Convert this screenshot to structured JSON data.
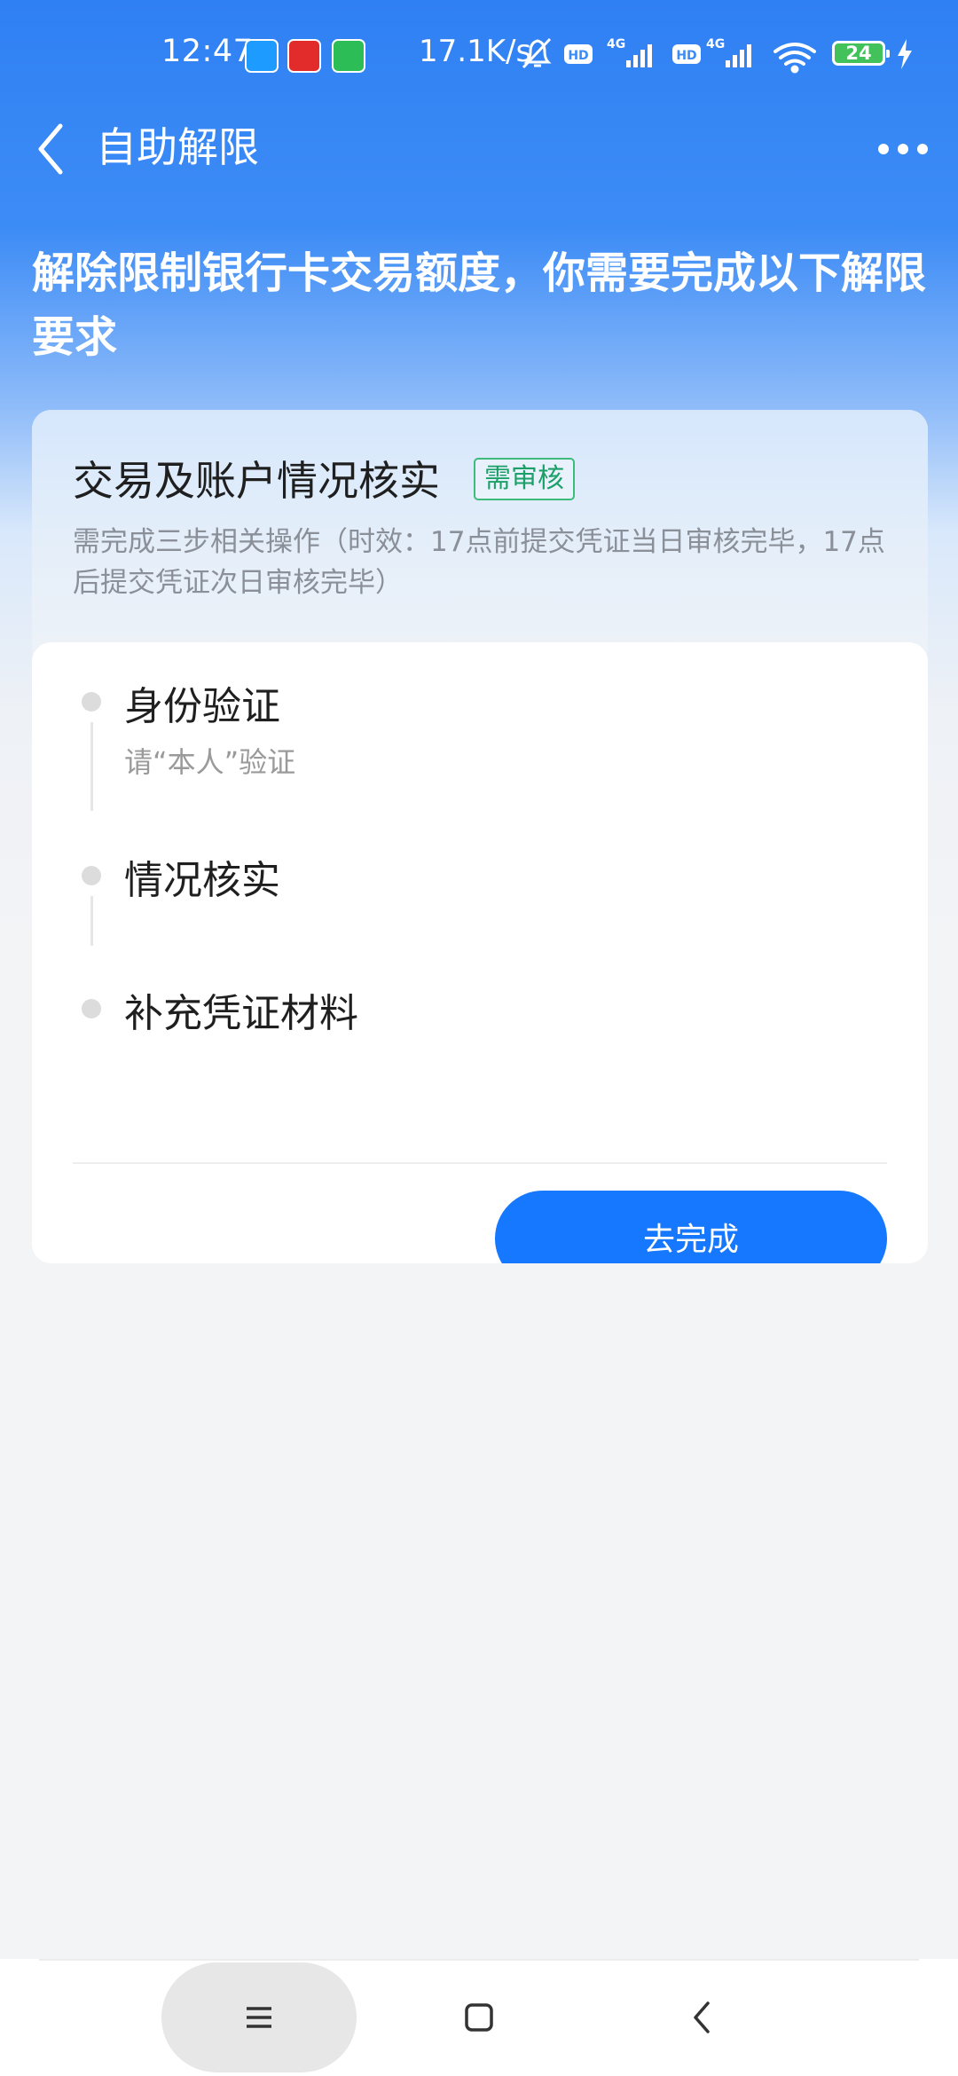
{
  "status_bar": {
    "time": "12:47",
    "net_speed": "17.1K/s",
    "battery": "24",
    "icons": [
      "alipay-app-icon",
      "pinduoduo-app-icon",
      "wechat-mini-icon",
      "mute-bell-icon",
      "hd-icon",
      "4g-signal-icon",
      "hd-icon",
      "4g-signal-icon",
      "wifi-icon",
      "battery-icon",
      "charging-bolt-icon"
    ]
  },
  "nav": {
    "title": "自助解限",
    "back_icon": "chevron-left-icon",
    "more_icon": "more-dots-icon"
  },
  "headline": "解除限制银行卡交易额度，你需要完成以下解限要求",
  "card": {
    "title": "交易及账户情况核实",
    "badge": "需审核",
    "subtitle": "需完成三步相关操作（时效：17点前提交凭证当日审核完毕，17点后提交凭证次日审核完毕）",
    "steps": [
      {
        "title": "身份验证",
        "subtitle": "请“本人”验证"
      },
      {
        "title": "情况核实",
        "subtitle": ""
      },
      {
        "title": "补充凭证材料",
        "subtitle": ""
      }
    ],
    "button": "去完成"
  },
  "system_nav": {
    "icons": [
      "menu-icon",
      "home-square-icon",
      "back-chevron-icon"
    ]
  },
  "colors": {
    "primary": "#1677ff",
    "badge": "#1ba067",
    "header_blue": "#2f80f3"
  }
}
